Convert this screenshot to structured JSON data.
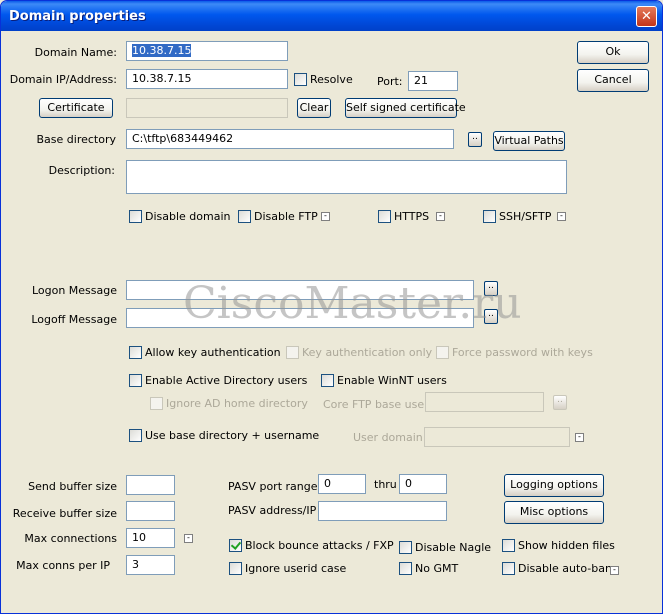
{
  "window": {
    "title": "Domain properties",
    "close_glyph": "✕"
  },
  "domain_name": {
    "label": "Domain Name:",
    "value": "10.38.7.15"
  },
  "domain_ip": {
    "label": "Domain IP/Address:",
    "value": "10.38.7.15"
  },
  "resolve_label": "Resolve",
  "port": {
    "label": "Port:",
    "value": "21"
  },
  "buttons": {
    "ok": "Ok",
    "cancel": "Cancel",
    "certificate": "Certificate",
    "clear": "Clear",
    "self_signed": "Self signed certificate",
    "browse": "..",
    "virtual_paths": "Virtual Paths",
    "logging_options": "Logging options",
    "misc_options": "Misc options"
  },
  "base_directory": {
    "label": "Base directory",
    "value": "C:\\tftp\\683449462"
  },
  "description_label": "Description:",
  "options": {
    "disable_domain": "Disable domain",
    "disable_ftp": "Disable FTP",
    "https": "HTTPS",
    "ssh_sftp": "SSH/SFTP"
  },
  "logon_message_label": "Logon Message",
  "logoff_message_label": "Logoff Message",
  "auth": {
    "allow_key": "Allow key authentication",
    "key_only": "Key authentication only",
    "force_password": "Force password with keys"
  },
  "ad": {
    "enable_ad": "Enable Active Directory users",
    "enable_winnt": "Enable WinNT users",
    "ignore_ad_home": "Ignore AD home directory",
    "core_ftp_base_user": "Core FTP base user",
    "use_base_dir": "Use base directory + username",
    "user_domain": "User domain"
  },
  "buffers": {
    "send_label": "Send buffer size",
    "send_value": "",
    "receive_label": "Receive buffer size",
    "receive_value": "",
    "max_conn_label": "Max connections",
    "max_conn_value": "10",
    "max_per_ip_label": "Max conns per IP",
    "max_per_ip_value": "3"
  },
  "pasv": {
    "port_range_label": "PASV port range",
    "from": "0",
    "thru_label": "thru",
    "to": "0",
    "address_label": "PASV address/IP",
    "address_value": ""
  },
  "bottom_checks": {
    "block_bounce": "Block bounce attacks / FXP",
    "ignore_userid_case": "Ignore userid case",
    "disable_nagle": "Disable Nagle",
    "no_gmt": "No GMT",
    "show_hidden": "Show hidden files",
    "disable_autoban": "Disable auto-ban"
  },
  "watermark": "CiscoMaster.ru",
  "colors": {
    "titlebar": "#0058EE",
    "face": "#ECE9D8",
    "selection": "#316AC5"
  }
}
